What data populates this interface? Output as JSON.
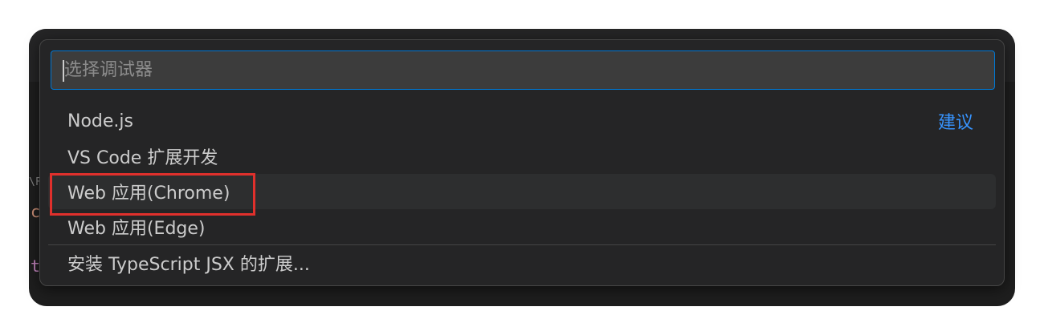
{
  "quick_pick": {
    "placeholder": "选择调试器",
    "items": [
      {
        "label": "Node.js",
        "tag": "建议"
      },
      {
        "label": "VS Code 扩展开发"
      },
      {
        "label": "Web 应用(Chrome)"
      },
      {
        "label": "Web 应用(Edge)"
      }
    ],
    "footer_item": {
      "label": "安装 TypeScript JSX 的扩展..."
    }
  },
  "editor_behind": {
    "fragments": [
      "\\F",
      "c",
      "t"
    ]
  },
  "colors": {
    "accent": "#0078d4",
    "tag": "#3794ff",
    "highlight_annotation": "#e0302c"
  }
}
